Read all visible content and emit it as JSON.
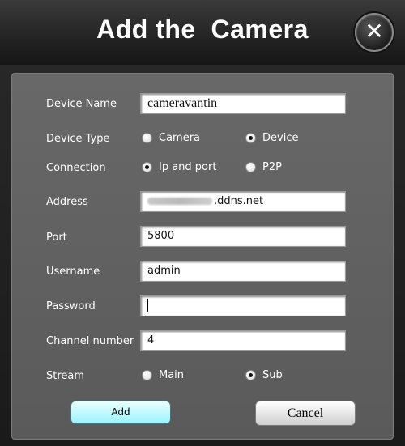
{
  "title": "Add the  Camera",
  "close_glyph": "✕",
  "form": {
    "device_name": {
      "label": "Device Name",
      "value": "cameravantin"
    },
    "device_type": {
      "label": "Device Type",
      "options": [
        "Camera",
        "Device"
      ],
      "selected": "Device"
    },
    "connection": {
      "label": "Connection",
      "options": [
        "Ip and port",
        "P2P"
      ],
      "selected": "Ip and port"
    },
    "address": {
      "label": "Address",
      "value": ".ddns.net"
    },
    "port": {
      "label": "Port",
      "value": "5800"
    },
    "username": {
      "label": "Username",
      "value": "admin"
    },
    "password": {
      "label": "Password",
      "value": ""
    },
    "channel": {
      "label": "Channel number",
      "value": "4"
    },
    "stream": {
      "label": "Stream",
      "options": [
        "Main",
        "Sub"
      ],
      "selected": "Sub"
    }
  },
  "buttons": {
    "add": "Add",
    "cancel": "Cancel"
  },
  "colors": {
    "add_button": "#9af4ff",
    "panel": "#606060",
    "titlebar": "#232323"
  },
  "icons": {
    "close": "close-icon",
    "radio": "radio-button-icon"
  }
}
